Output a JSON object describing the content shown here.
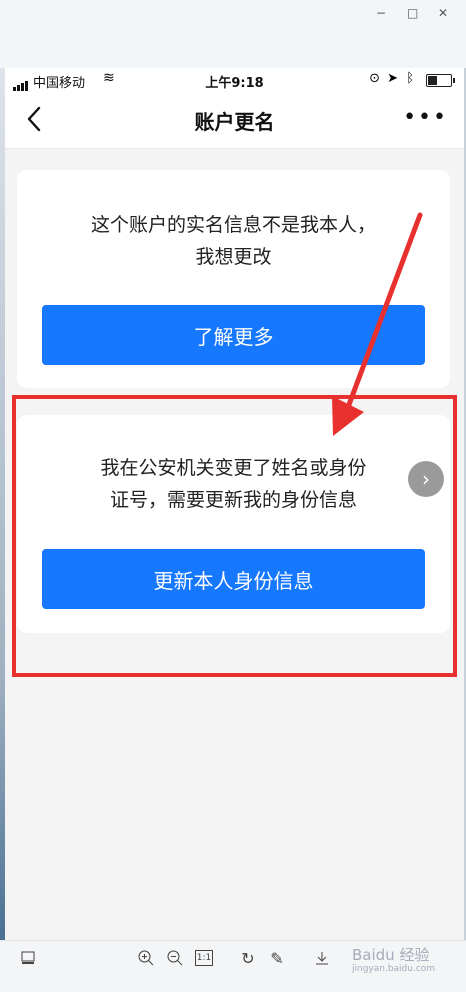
{
  "window": {
    "controls": [
      "−",
      "□",
      "✕"
    ]
  },
  "status_bar": {
    "carrier": "中国移动",
    "time": "上午9:18"
  },
  "navbar": {
    "title": "账户更名"
  },
  "cards": [
    {
      "text_line1": "这个账户的实名信息不是我本人，",
      "text_line2": "我想更改",
      "button": "了解更多"
    },
    {
      "text_line1": "我在公安机关变更了姓名或身份",
      "text_line2": "证号，需要更新我的身份信息",
      "button": "更新本人身份信息"
    }
  ],
  "toolbar": {
    "icons": [
      "thumbnail-icon",
      "zoom-in-icon",
      "zoom-out-icon",
      "actual-size-icon",
      "rotate-icon",
      "edit-icon",
      "download-icon"
    ],
    "actual_size_label": "1:1",
    "watermark": "Baidu 经验",
    "watermark_sub": "jingyan.baidu.com"
  },
  "colors": {
    "accent": "#1677ff",
    "highlight": "#e8312e"
  }
}
